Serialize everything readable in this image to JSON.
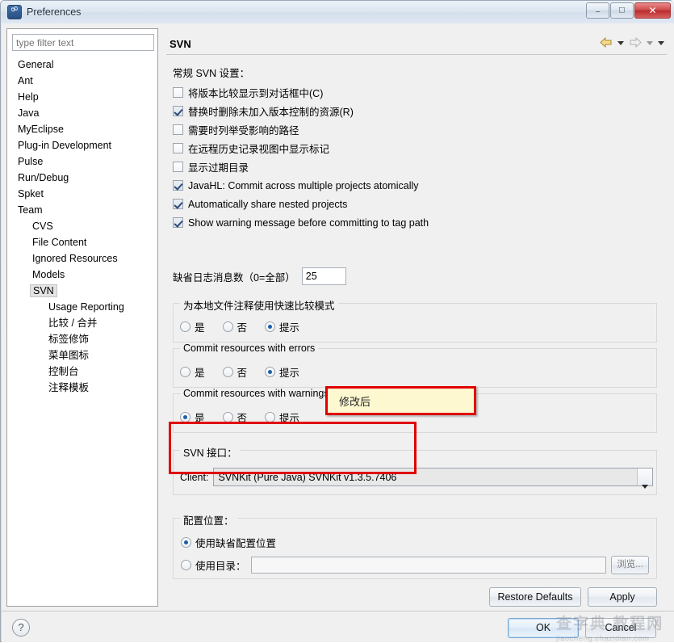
{
  "window": {
    "title": "Preferences",
    "icon": "svn-link-icon",
    "buttons": {
      "minimize": "–",
      "maximize": "□",
      "close": "✕"
    }
  },
  "sidebar": {
    "filter_placeholder": "type filter text",
    "filter_value": "",
    "items": [
      {
        "label": "General",
        "depth": 0,
        "selected": false
      },
      {
        "label": "Ant",
        "depth": 0,
        "selected": false
      },
      {
        "label": "Help",
        "depth": 0,
        "selected": false
      },
      {
        "label": "Java",
        "depth": 0,
        "selected": false
      },
      {
        "label": "MyEclipse",
        "depth": 0,
        "selected": false
      },
      {
        "label": "Plug-in Development",
        "depth": 0,
        "selected": false
      },
      {
        "label": "Pulse",
        "depth": 0,
        "selected": false
      },
      {
        "label": "Run/Debug",
        "depth": 0,
        "selected": false
      },
      {
        "label": "Spket",
        "depth": 0,
        "selected": false
      },
      {
        "label": "Team",
        "depth": 0,
        "selected": false
      },
      {
        "label": "CVS",
        "depth": 1,
        "selected": false
      },
      {
        "label": "File Content",
        "depth": 1,
        "selected": false
      },
      {
        "label": "Ignored Resources",
        "depth": 1,
        "selected": false
      },
      {
        "label": "Models",
        "depth": 1,
        "selected": false
      },
      {
        "label": "SVN",
        "depth": 1,
        "selected": true
      },
      {
        "label": "Usage Reporting",
        "depth": 2,
        "selected": false
      },
      {
        "label": "比较 / 合并",
        "depth": 2,
        "selected": false
      },
      {
        "label": "标签修饰",
        "depth": 2,
        "selected": false
      },
      {
        "label": "菜单图标",
        "depth": 2,
        "selected": false
      },
      {
        "label": "控制台",
        "depth": 2,
        "selected": false
      },
      {
        "label": "注释模板",
        "depth": 2,
        "selected": false
      }
    ]
  },
  "page": {
    "title": "SVN",
    "nav": {
      "back_icon": "back-arrow-icon",
      "back_menu_icon": "chevron-down-icon",
      "forward_icon": "forward-arrow-icon",
      "forward_menu_icon": "chevron-down-icon",
      "view_menu_icon": "chevron-down-icon"
    },
    "general_section_label": "常规 SVN 设置：",
    "checkboxes": [
      {
        "label": "将版本比较显示到对话框中(C)",
        "checked": false
      },
      {
        "label": "替换时删除未加入版本控制的资源(R)",
        "checked": true
      },
      {
        "label": "需要时列举受影响的路径",
        "checked": false
      },
      {
        "label": "在远程历史记录视图中显示标记",
        "checked": false
      },
      {
        "label": "显示过期目录",
        "checked": false
      },
      {
        "label": "JavaHL: Commit across multiple projects atomically",
        "checked": true
      },
      {
        "label": "Automatically share nested projects",
        "checked": true
      },
      {
        "label": "Show warning message before committing to tag path",
        "checked": true
      }
    ],
    "log_messages": {
      "label": "缺省日志消息数（0=全部）",
      "value": "25"
    },
    "radio_groups": [
      {
        "title": "为本地文件注释使用快速比较模式",
        "options": [
          "是",
          "否",
          "提示"
        ],
        "selected": 2
      },
      {
        "title": "Commit resources with errors",
        "options": [
          "是",
          "否",
          "提示"
        ],
        "selected": 2
      },
      {
        "title": "Commit resources with warnings",
        "options": [
          "是",
          "否",
          "提示"
        ],
        "selected": 0
      }
    ],
    "svn_interface": {
      "title": "SVN 接口：",
      "client_label": "Client:",
      "client_value": "SVNKit (Pure Java) SVNKit v1.3.5.7406",
      "dropdown_icon": "chevron-down-icon"
    },
    "config_location": {
      "title": "配置位置：",
      "option_default": "使用缺省配置位置",
      "option_directory": "使用目录：",
      "selected": 0,
      "directory_value": "",
      "browse_label": "浏览..."
    },
    "page_buttons": {
      "restore_defaults": "Restore Defaults",
      "apply": "Apply"
    }
  },
  "dialog_buttons": {
    "ok": "OK",
    "cancel": "Cancel",
    "help_icon": "question-mark-icon"
  },
  "annotations": {
    "note_text": "修改后",
    "highlight_color": "#e00000",
    "note_background": "#fdf8d0"
  },
  "watermark": {
    "main": "查字典 教程网",
    "sub": "jiaocheng.chazidian.com"
  }
}
